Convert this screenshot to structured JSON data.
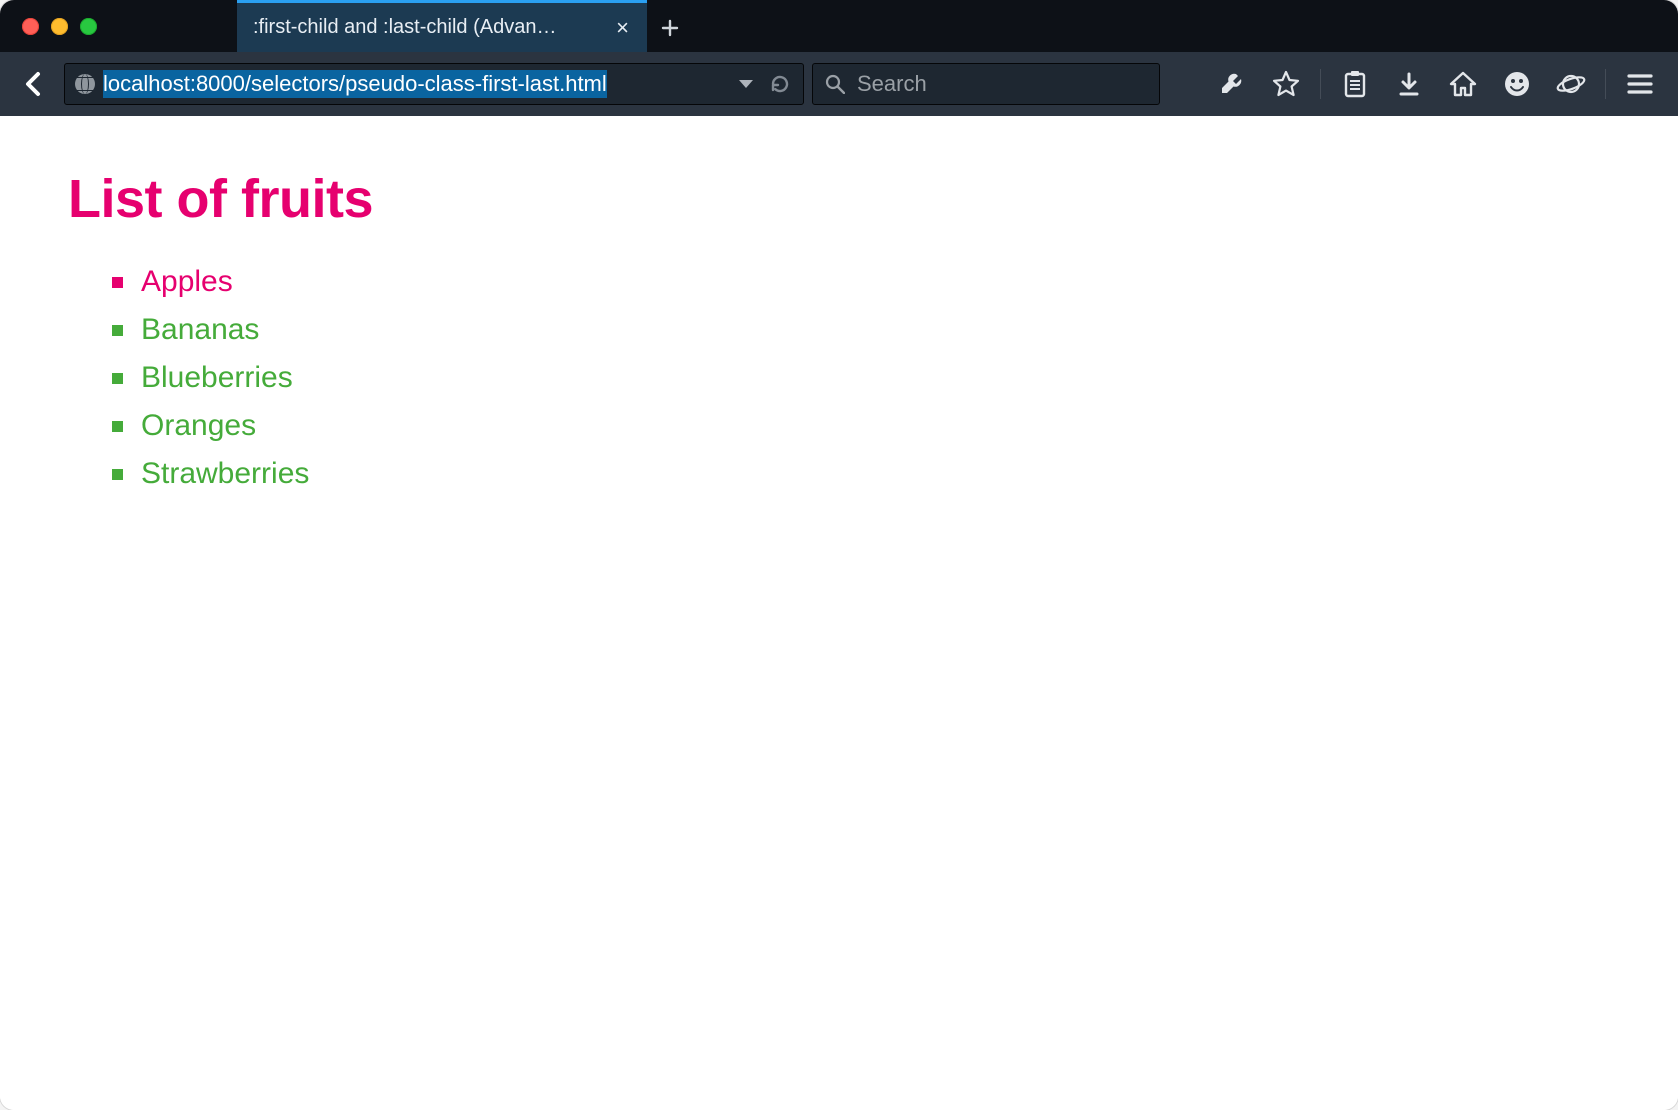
{
  "window": {
    "tab_title": ":first-child and :last-child (Advan…"
  },
  "toolbar": {
    "url": "localhost:8000/selectors/pseudo-class-first-last.html",
    "search_placeholder": "Search"
  },
  "page": {
    "heading": "List of fruits",
    "items": [
      "Apples",
      "Bananas",
      "Blueberries",
      "Oranges",
      "Strawberries"
    ]
  },
  "colors": {
    "heading": "#e6006f",
    "first_item": "#e6006f",
    "other_items": "#45ab3a"
  }
}
